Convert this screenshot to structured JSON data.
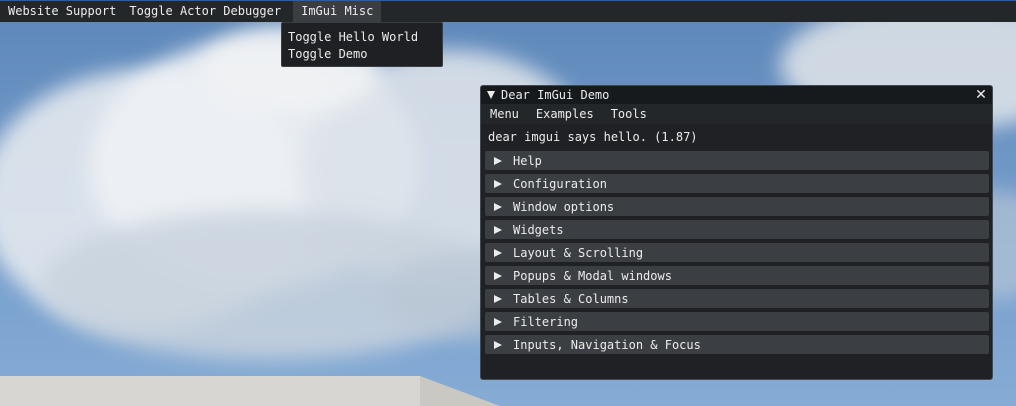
{
  "main_menu": {
    "items": [
      "Website Support",
      "Toggle Actor Debugger",
      "ImGui Misc"
    ],
    "active_index": 2
  },
  "dropdown": {
    "items": [
      "Toggle Hello World",
      "Toggle Demo"
    ]
  },
  "demo_window": {
    "title": "Dear ImGui Demo",
    "close_glyph": "✕",
    "menu": [
      "Menu",
      "Examples",
      "Tools"
    ],
    "hello_text": "dear imgui says hello. (1.87)",
    "headers": [
      "Help",
      "Configuration",
      "Window options",
      "Widgets",
      "Layout & Scrolling",
      "Popups & Modal windows",
      "Tables & Columns",
      "Filtering",
      "Inputs, Navigation & Focus"
    ]
  },
  "colors": {
    "menubar_bg": "#24272a",
    "window_bg": "#1f2124",
    "header_bg": "#3b3e42",
    "accent_line": "#2d5f9a",
    "text": "#ececec"
  }
}
